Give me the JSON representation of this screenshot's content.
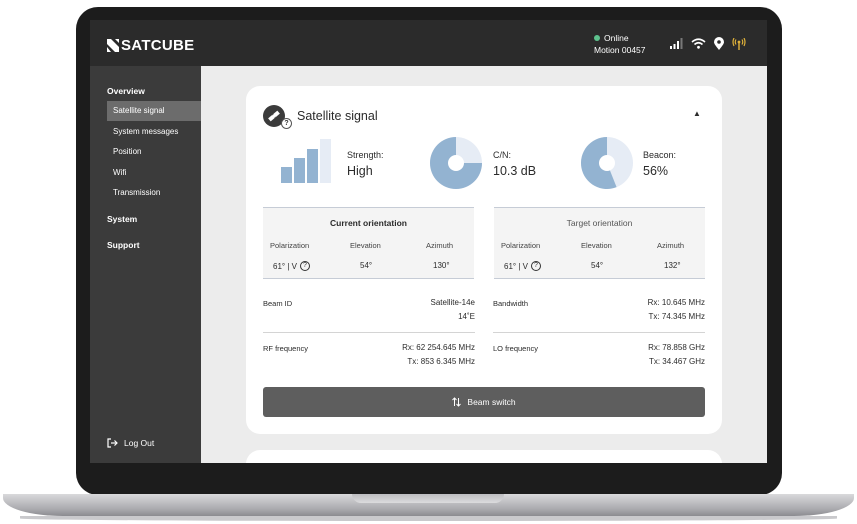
{
  "header": {
    "logo_text": "SATCUBE",
    "status": "Online",
    "device": "Motion 00457",
    "colors": {
      "online": "#5ec28e",
      "alert_icon": "#e0b23a"
    },
    "icons": [
      "signal-bars-icon",
      "wifi-icon",
      "location-pin-icon",
      "antenna-icon"
    ]
  },
  "sidebar": {
    "sections": [
      {
        "label": "Overview",
        "items": [
          "Satellite signal",
          "System messages",
          "Position",
          "Wifi",
          "Transmission"
        ]
      },
      {
        "label": "System"
      },
      {
        "label": "Support"
      }
    ],
    "active_item": "Satellite signal",
    "logout_label": "Log Out"
  },
  "card": {
    "title": "Satellite signal",
    "strength": {
      "label": "Strength:",
      "value": "High"
    },
    "cn": {
      "label": "C/N:",
      "value": "10.3 dB",
      "fill_fraction": 0.75
    },
    "beacon": {
      "label": "Beacon:",
      "value": "56%",
      "fill_fraction": 0.56
    },
    "current_orientation": {
      "title": "Current orientation",
      "headers": [
        "Polarization",
        "Elevation",
        "Azimuth"
      ],
      "values": [
        "61° | V",
        "54°",
        "130°"
      ]
    },
    "target_orientation": {
      "title": "Target orientation",
      "headers": [
        "Polarization",
        "Elevation",
        "Azimuth"
      ],
      "values": [
        "61° | V",
        "54°",
        "132°"
      ]
    },
    "beam_id": {
      "label": "Beam ID",
      "line1": "Satellite-14e",
      "line2": "14˚E"
    },
    "bandwidth": {
      "label": "Bandwidth",
      "line1": "Rx: 10.645 MHz",
      "line2": "Tx: 74.345 MHz"
    },
    "rf_frequency": {
      "label": "RF frequency",
      "line1": "Rx: 62 254.645 MHz",
      "line2": "Tx: 853 6.345 MHz"
    },
    "lo_frequency": {
      "label": "LO frequency",
      "line1": "Rx: 78.858 GHz",
      "line2": "Tx: 34.467 GHz"
    },
    "beam_switch_label": "Beam switch"
  }
}
